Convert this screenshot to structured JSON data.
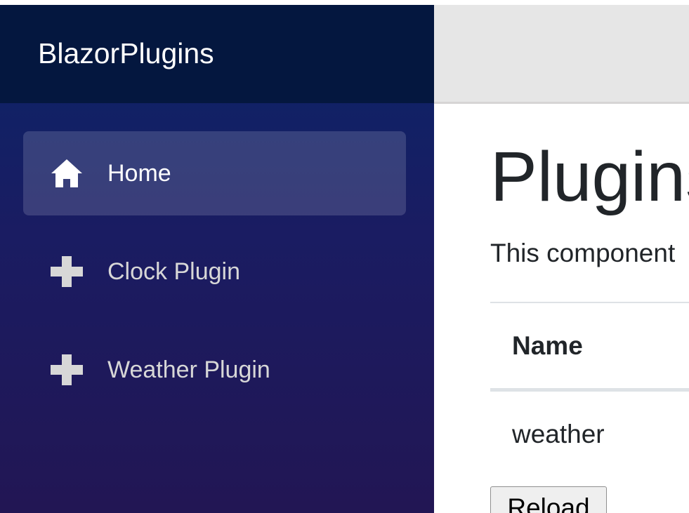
{
  "app": {
    "brand": "BlazorPlugins"
  },
  "sidebar": {
    "items": [
      {
        "label": "Home",
        "icon": "home-icon",
        "active": true
      },
      {
        "label": "Clock Plugin",
        "icon": "plus-icon",
        "active": false
      },
      {
        "label": "Weather Plugin",
        "icon": "plus-icon",
        "active": false
      }
    ]
  },
  "main": {
    "title": "Plugins",
    "description": "This component",
    "table": {
      "headers": [
        "Name"
      ],
      "rows": [
        [
          "weather"
        ]
      ]
    },
    "reload_label": "Reload"
  },
  "colors": {
    "brand_bar": "#04173f",
    "sidebar_top": "#0a2568",
    "sidebar_bottom": "#221654",
    "topbar": "#e6e6e6",
    "text": "#212529"
  }
}
